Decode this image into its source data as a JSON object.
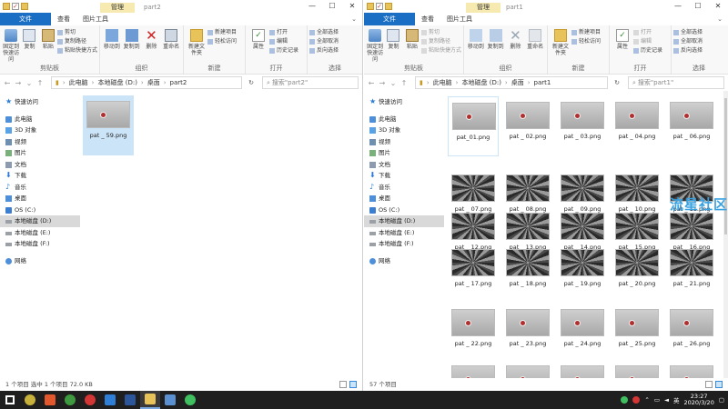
{
  "left": {
    "ribbon_context_tab": "管理",
    "title": "part2",
    "tabs": [
      "文件",
      "主页",
      "共享",
      "查看",
      "图片工具"
    ],
    "ribbon": {
      "pin_label": "固定到快速访问",
      "copy_label": "复制",
      "paste_label": "粘贴",
      "cut_label": "剪切",
      "copy_path_label": "复制路径",
      "paste_shortcut_label": "粘贴快捷方式",
      "clipboard_group": "剪贴板",
      "move_to_label": "移动到",
      "copy_to_label": "复制到",
      "delete_label": "删除",
      "rename_label": "重命名",
      "organize_group": "组织",
      "new_folder_label": "新建文件夹",
      "new_item_label": "新建项目",
      "easy_access_label": "轻松访问",
      "new_group": "新建",
      "properties_label": "属性",
      "open_label": "打开",
      "edit_label": "编辑",
      "history_label": "历史记录",
      "open_group": "打开",
      "select_all_label": "全部选择",
      "select_none_label": "全部取消",
      "invert_label": "反向选择",
      "select_group": "选择"
    },
    "address": [
      "此电脑",
      "本地磁盘 (D:)",
      "桌面",
      "part2"
    ],
    "search_placeholder": "搜索\"part2\"",
    "files": [
      "pat _ 59.png"
    ],
    "status": "1 个项目   选中 1 个项目  72.0 KB"
  },
  "right": {
    "ribbon_context_tab": "管理",
    "title": "part1",
    "tabs": [
      "文件",
      "主页",
      "共享",
      "查看",
      "图片工具"
    ],
    "address": [
      "此电脑",
      "本地磁盘 (D:)",
      "桌面",
      "part1"
    ],
    "search_placeholder": "搜索\"part1\"",
    "files": [
      "pat_01.png",
      "pat _ 02.png",
      "pat _ 03.png",
      "pat _ 04.png",
      "pat _ 06.png",
      "pat _ 07.png",
      "pat _ 08.png",
      "pat _ 09.png",
      "pat _ 10.png",
      "pat _ 11.png",
      "pat _ 12.png",
      "pat _ 13.png",
      "pat _ 14.png",
      "pat _ 15.png",
      "pat _ 16.png",
      "pat _ 17.png",
      "pat _ 18.png",
      "pat _ 19.png",
      "pat _ 20.png",
      "pat _ 21.png",
      "pat _ 22.png",
      "pat _ 23.png",
      "pat _ 24.png",
      "pat _ 25.png",
      "pat _ 26.png",
      "",
      "",
      "",
      "",
      ""
    ],
    "thumb_styles": [
      "face",
      "face",
      "face",
      "face",
      "face",
      "swirl",
      "swirl",
      "swirl",
      "swirl",
      "swirl",
      "swirl",
      "swirl",
      "swirl",
      "swirl",
      "swirl",
      "swirl",
      "swirl",
      "swirl",
      "swirl",
      "swirl",
      "face",
      "face",
      "face",
      "face",
      "face",
      "face",
      "face",
      "face",
      "face",
      "face"
    ],
    "status": "57 个项目",
    "watermark": "流星社区"
  },
  "nav_pane": [
    {
      "label": "快速访问",
      "icon": "star-icon"
    },
    {
      "label": "此电脑",
      "icon": "computer-icon"
    },
    {
      "label": "3D 对象",
      "icon": "cube-icon"
    },
    {
      "label": "视频",
      "icon": "video-icon"
    },
    {
      "label": "图片",
      "icon": "picture-icon"
    },
    {
      "label": "文档",
      "icon": "document-icon"
    },
    {
      "label": "下载",
      "icon": "download-icon"
    },
    {
      "label": "音乐",
      "icon": "music-icon"
    },
    {
      "label": "桌面",
      "icon": "desktop-icon"
    },
    {
      "label": "OS (C:)",
      "icon": "os-drive-icon"
    },
    {
      "label": "本地磁盘 (D:)",
      "icon": "drive-icon",
      "selected": true
    },
    {
      "label": "本地磁盘 (E:)",
      "icon": "drive-icon"
    },
    {
      "label": "本地磁盘 (F:)",
      "icon": "drive-icon"
    },
    {
      "label": "网络",
      "icon": "network-icon"
    }
  ],
  "taskbar": {
    "apps": [
      "windows-start-icon",
      "chrome-like-icon",
      "h-app-icon",
      "chrome-icon",
      "netease-music-icon",
      "edge-icon",
      "word-icon",
      "file-explorer-icon",
      "notes-icon",
      "wechat-icon"
    ],
    "colors": [
      "#ffffff",
      "#c8b13a",
      "#e2572c",
      "#3f9a3f",
      "#d43535",
      "#2f7fd7",
      "#2b579a",
      "#e8c35a",
      "#5a8fd0",
      "#3fbf5f"
    ],
    "time": "23:27",
    "date": "2020/3/20"
  }
}
